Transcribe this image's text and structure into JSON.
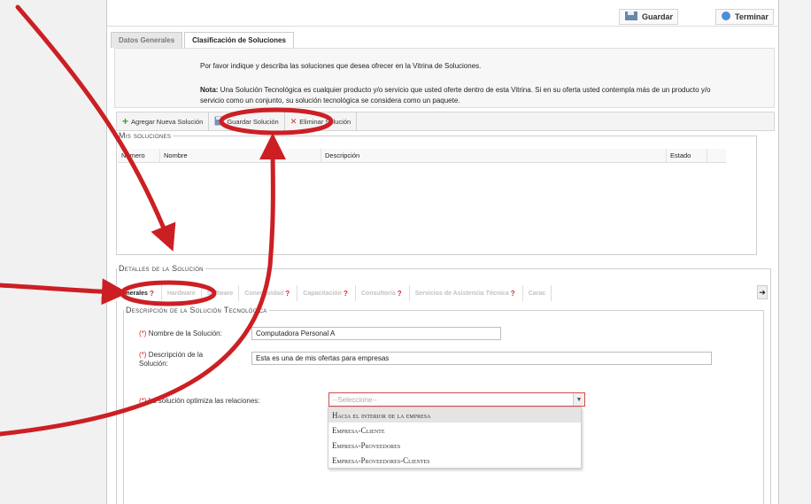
{
  "header": {
    "guardar": "Guardar",
    "terminar": "Terminar"
  },
  "tabs": [
    {
      "label": "Datos Generales"
    },
    {
      "label": "Clasificación de Soluciones"
    }
  ],
  "intro": {
    "text": "Por favor indique y describa las soluciones que desea ofrecer en la Vitrina de Soluciones.",
    "note_label": "Nota:",
    "note_text": " Una Solución Tecnológica es cualquier producto y/o servicio que usted oferte dentro de esta Vitrina. Si en su oferta usted contempla más de un producto y/o servicio como un conjunto, su solución tecnológica se considera como un paquete."
  },
  "toolbar": {
    "add": "Agregar Nueva Solución",
    "save": "Guardar Solución",
    "delete": "Eliminar Solución"
  },
  "mis_soluciones": {
    "legend": "Mis soluciones",
    "columns": [
      "Número",
      "Nombre",
      "Descripción",
      "Estado"
    ]
  },
  "detalles": {
    "legend": "Detalles de la Solución",
    "tabs": [
      {
        "label": "Generales"
      },
      {
        "label": "Hardware"
      },
      {
        "label": "Software"
      },
      {
        "label": "Conectividad"
      },
      {
        "label": "Capacitación"
      },
      {
        "label": "Consultoría"
      },
      {
        "label": "Servicios de Asistencia Técnica"
      },
      {
        "label": "Carac"
      }
    ]
  },
  "descripcion": {
    "legend": "Descripción de la Solución Tecnológica",
    "req_mark": "(*)",
    "nombre_label": "Nombre de la Solución:",
    "nombre_value": "Computadora Personal A",
    "desc_label_1": "Descripción de la",
    "desc_label_2": "Solución:",
    "desc_value": "Esta es una de mis ofertas para empresas",
    "optimiza_label": "La solución optimiza las relaciones:",
    "select_placeholder": "--Seleccione--",
    "options": [
      "Hacia el interior de la empresa",
      "Empresa-Cliente",
      "Empresa-Proveedores",
      "Empresa-Proveedores-Clientes"
    ]
  },
  "colors": {
    "accent_red": "#cc1f24",
    "border": "#cfcfcf",
    "add_green": "#3aa43a"
  }
}
